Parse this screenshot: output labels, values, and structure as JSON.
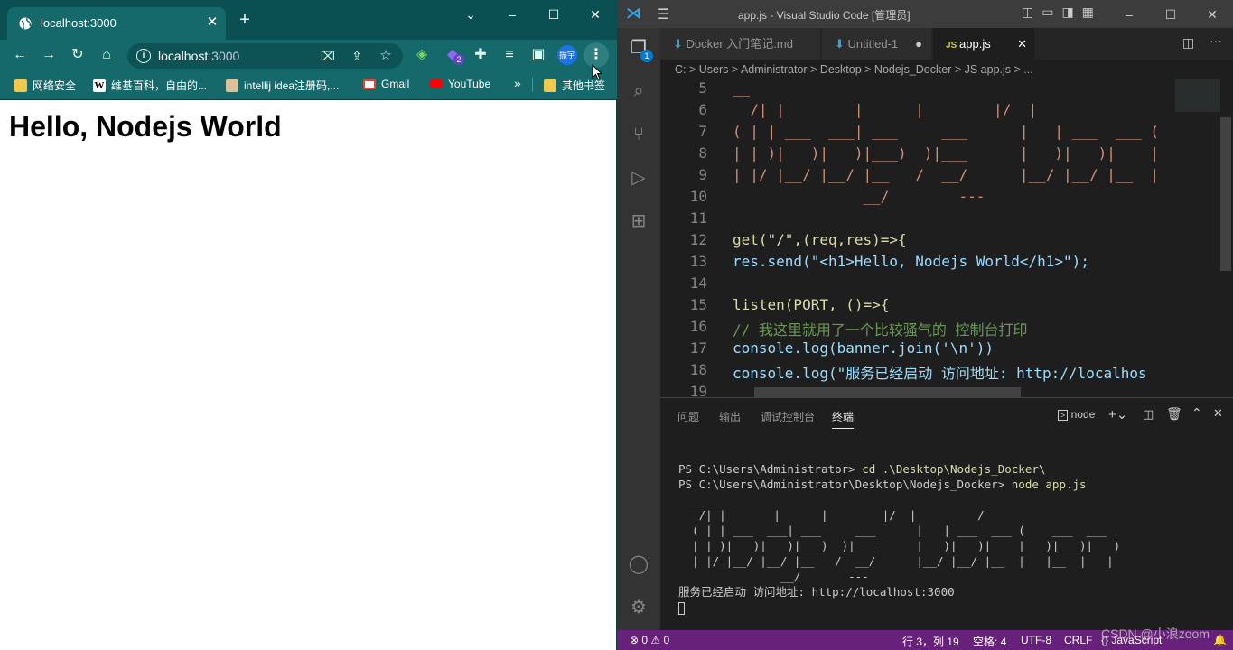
{
  "browser": {
    "tab_title": "localhost:3000",
    "address_host": "localhost",
    "address_port": ":3000",
    "extension_badge": "2",
    "profile_label": "振宇",
    "bookmarks": [
      {
        "label": "网络安全",
        "icon": "folder-icon",
        "color": "#f2c94c"
      },
      {
        "label": "维基百科，自由的...",
        "icon": "wikipedia-icon",
        "color": "#ffffff"
      },
      {
        "label": "intellij idea注册码,...",
        "icon": "site-icon",
        "color": "#e0c09a"
      },
      {
        "label": "Gmail",
        "icon": "gmail-icon",
        "color": "#ea4335"
      },
      {
        "label": "YouTube",
        "icon": "youtube-icon",
        "color": "#ff0000"
      }
    ],
    "bookmarks_more": "»",
    "other_bookmarks": "其他书签",
    "page_heading": "Hello, Nodejs World"
  },
  "vscode": {
    "window_title": "app.js - Visual Studio Code [管理员]",
    "explorer_badge": "1",
    "tabs": [
      {
        "label": "Docker 入门笔记.md",
        "active": false
      },
      {
        "label": "Untitled-1",
        "active": false
      },
      {
        "label": "app.js",
        "active": true
      }
    ],
    "breadcrumb": "C: > Users > Administrator > Desktop > Nodejs_Docker > JS app.js > ...",
    "lines": [
      {
        "n": "5",
        "t": "__"
      },
      {
        "n": "6",
        "t": "  /| |        |      |        |/  |"
      },
      {
        "n": "7",
        "t": "( | | ___  ___| ___     ___      |   | ___  ___ ("
      },
      {
        "n": "8",
        "t": "| | )|   )|   )|___)  )|___      |   )|   )|    |"
      },
      {
        "n": "9",
        "t": "| |/ |__/ |__/ |__   /  __/      |__/ |__/ |__  |"
      },
      {
        "n": "10",
        "t": "               __/        ---"
      },
      {
        "n": "11",
        "t": ""
      },
      {
        "n": "12",
        "t": "get(\"/\",(req,res)=>{"
      },
      {
        "n": "13",
        "t": "res.send(\"<h1>Hello, Nodejs World</h1>\");"
      },
      {
        "n": "14",
        "t": ""
      },
      {
        "n": "15",
        "t": "listen(PORT, ()=>{"
      },
      {
        "n": "16",
        "t": "// 我这里就用了一个比较骚气的 控制台打印"
      },
      {
        "n": "17",
        "t": "console.log(banner.join('\\n'))"
      },
      {
        "n": "18",
        "t": "console.log(\"服务已经启动 访问地址: http://localhos"
      },
      {
        "n": "19",
        "t": ""
      }
    ],
    "panel_tabs": [
      "问题",
      "输出",
      "调试控制台",
      "终端"
    ],
    "terminal_name": "node",
    "terminal": {
      "prompt1": "PS C:\\Users\\Administrator> ",
      "cmd1": "cd .\\Desktop\\Nodejs_Docker\\",
      "prompt2": "PS C:\\Users\\Administrator\\Desktop\\Nodejs_Docker> ",
      "cmd2": "node app.js",
      "banner": "  __\n   /| |       |      |        |/  |         /\n  ( | | ___  ___| ___     ___      |   | ___  ___ (    ___  ___\n  | | )|   )|   )|___)  )|___      |   )|   )|    |___)|___)|   )\n  | |/ |__/ |__/ |__   /  __/      |__/ |__/ |__  |   |__  |   |\n               __/       ---",
      "started": "服务已经启动 访问地址: http://localhost:3000"
    },
    "status": {
      "problems": "⊗ 0 ⚠ 0",
      "position": "行 3，列 19",
      "spaces": "空格: 4",
      "encoding": "UTF-8",
      "eol": "CRLF",
      "language": "{} JavaScript"
    }
  },
  "watermark": "CSDN @小浪zoom"
}
